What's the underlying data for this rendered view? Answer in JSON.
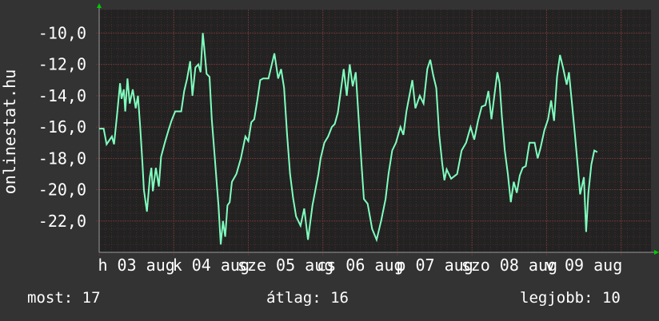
{
  "chart_data": {
    "type": "line",
    "ylabel": "onlinestat.hu",
    "ylim": [
      -24,
      -8.5
    ],
    "yticks": [
      -10,
      -12,
      -14,
      -16,
      -18,
      -20,
      -22
    ],
    "ytick_labels": [
      "-10,0",
      "-12,0",
      "-14,0",
      "-16,0",
      "-18,0",
      "-20,0",
      "-22,0"
    ],
    "xticks": [
      {
        "label": "h 03 aug",
        "x": 0.5
      },
      {
        "label": "k 04 aug",
        "x": 1.5
      },
      {
        "label": "sze 05 aug",
        "x": 2.5
      },
      {
        "label": "cs 06 aug",
        "x": 3.5
      },
      {
        "label": "p 07 aug",
        "x": 4.5
      },
      {
        "label": "szo 08 aug",
        "x": 5.5
      },
      {
        "label": "v 09 aug",
        "x": 6.5
      }
    ],
    "xlim": [
      0,
      7.4
    ],
    "grid": true,
    "colors": {
      "background": "#333333",
      "plot_background": "#222222",
      "grid": "#4a2d2d",
      "line": "#7fffbf",
      "axis_arrow": "#00cc00"
    },
    "series": [
      {
        "values": [
          [
            0.0,
            -16.1
          ],
          [
            0.06,
            -16.1
          ],
          [
            0.1,
            -17.1
          ],
          [
            0.17,
            -16.6
          ],
          [
            0.2,
            -17.1
          ],
          [
            0.24,
            -15.2
          ],
          [
            0.28,
            -13.2
          ],
          [
            0.3,
            -14.2
          ],
          [
            0.33,
            -13.6
          ],
          [
            0.35,
            -15.0
          ],
          [
            0.38,
            -12.9
          ],
          [
            0.41,
            -14.5
          ],
          [
            0.45,
            -13.6
          ],
          [
            0.49,
            -14.8
          ],
          [
            0.52,
            -14.0
          ],
          [
            0.55,
            -16.0
          ],
          [
            0.58,
            -18.3
          ],
          [
            0.6,
            -20.0
          ],
          [
            0.64,
            -21.4
          ],
          [
            0.68,
            -19.2
          ],
          [
            0.7,
            -18.6
          ],
          [
            0.72,
            -20.1
          ],
          [
            0.76,
            -18.6
          ],
          [
            0.8,
            -19.8
          ],
          [
            0.83,
            -17.9
          ],
          [
            0.88,
            -17.0
          ],
          [
            0.93,
            -16.2
          ],
          [
            0.97,
            -15.6
          ],
          [
            1.02,
            -15.0
          ],
          [
            1.1,
            -15.0
          ],
          [
            1.14,
            -13.7
          ],
          [
            1.18,
            -12.9
          ],
          [
            1.22,
            -11.8
          ],
          [
            1.25,
            -14.0
          ],
          [
            1.29,
            -12.2
          ],
          [
            1.33,
            -12.0
          ],
          [
            1.36,
            -12.5
          ],
          [
            1.39,
            -10.0
          ],
          [
            1.41,
            -11.0
          ],
          [
            1.44,
            -12.6
          ],
          [
            1.48,
            -12.8
          ],
          [
            1.51,
            -15.5
          ],
          [
            1.55,
            -17.9
          ],
          [
            1.58,
            -19.8
          ],
          [
            1.6,
            -21.0
          ],
          [
            1.63,
            -23.5
          ],
          [
            1.66,
            -22.0
          ],
          [
            1.69,
            -23.0
          ],
          [
            1.72,
            -21.0
          ],
          [
            1.75,
            -20.8
          ],
          [
            1.78,
            -19.5
          ],
          [
            1.84,
            -19.0
          ],
          [
            1.9,
            -18.0
          ],
          [
            1.96,
            -16.6
          ],
          [
            2.0,
            -16.9
          ],
          [
            2.04,
            -15.7
          ],
          [
            2.08,
            -15.5
          ],
          [
            2.12,
            -14.3
          ],
          [
            2.16,
            -13.0
          ],
          [
            2.2,
            -12.9
          ],
          [
            2.27,
            -12.9
          ],
          [
            2.32,
            -11.9
          ],
          [
            2.35,
            -11.3
          ],
          [
            2.4,
            -12.9
          ],
          [
            2.44,
            -12.3
          ],
          [
            2.48,
            -13.5
          ],
          [
            2.52,
            -16.5
          ],
          [
            2.56,
            -19.0
          ],
          [
            2.6,
            -20.5
          ],
          [
            2.64,
            -21.7
          ],
          [
            2.7,
            -22.3
          ],
          [
            2.75,
            -21.2
          ],
          [
            2.8,
            -23.2
          ],
          [
            2.86,
            -21.0
          ],
          [
            2.9,
            -20.0
          ],
          [
            2.94,
            -19.0
          ],
          [
            2.97,
            -18.0
          ],
          [
            3.02,
            -17.0
          ],
          [
            3.07,
            -16.6
          ],
          [
            3.12,
            -16.0
          ],
          [
            3.16,
            -15.8
          ],
          [
            3.2,
            -15.1
          ],
          [
            3.24,
            -13.7
          ],
          [
            3.28,
            -12.3
          ],
          [
            3.32,
            -14.0
          ],
          [
            3.36,
            -12.0
          ],
          [
            3.4,
            -13.4
          ],
          [
            3.44,
            -12.5
          ],
          [
            3.48,
            -15.5
          ],
          [
            3.52,
            -18.5
          ],
          [
            3.55,
            -20.6
          ],
          [
            3.6,
            -20.9
          ],
          [
            3.66,
            -22.5
          ],
          [
            3.72,
            -23.2
          ],
          [
            3.78,
            -22.0
          ],
          [
            3.84,
            -20.6
          ],
          [
            3.88,
            -19.0
          ],
          [
            3.93,
            -17.5
          ],
          [
            3.98,
            -17.0
          ],
          [
            4.04,
            -16.0
          ],
          [
            4.08,
            -16.5
          ],
          [
            4.12,
            -15.0
          ],
          [
            4.16,
            -14.0
          ],
          [
            4.2,
            -13.0
          ],
          [
            4.24,
            -14.8
          ],
          [
            4.3,
            -14.0
          ],
          [
            4.35,
            -14.5
          ],
          [
            4.4,
            -12.3
          ],
          [
            4.44,
            -11.7
          ],
          [
            4.48,
            -12.7
          ],
          [
            4.52,
            -13.5
          ],
          [
            4.56,
            -16.5
          ],
          [
            4.6,
            -18.3
          ],
          [
            4.63,
            -19.4
          ],
          [
            4.66,
            -18.7
          ],
          [
            4.72,
            -19.3
          ],
          [
            4.8,
            -19.0
          ],
          [
            4.86,
            -17.5
          ],
          [
            4.92,
            -17.0
          ],
          [
            4.98,
            -16.0
          ],
          [
            5.03,
            -16.8
          ],
          [
            5.08,
            -15.6
          ],
          [
            5.13,
            -14.7
          ],
          [
            5.18,
            -14.6
          ],
          [
            5.22,
            -13.7
          ],
          [
            5.26,
            -15.5
          ],
          [
            5.31,
            -13.6
          ],
          [
            5.34,
            -12.5
          ],
          [
            5.37,
            -13.2
          ],
          [
            5.4,
            -15.3
          ],
          [
            5.44,
            -17.5
          ],
          [
            5.48,
            -19.0
          ],
          [
            5.52,
            -20.8
          ],
          [
            5.56,
            -19.5
          ],
          [
            5.6,
            -20.2
          ],
          [
            5.64,
            -19.1
          ],
          [
            5.68,
            -18.6
          ],
          [
            5.72,
            -18.5
          ],
          [
            5.77,
            -17.0
          ],
          [
            5.84,
            -17.0
          ],
          [
            5.88,
            -18.0
          ],
          [
            5.92,
            -17.3
          ],
          [
            5.97,
            -16.2
          ],
          [
            6.02,
            -15.5
          ],
          [
            6.06,
            -14.3
          ],
          [
            6.1,
            -15.6
          ],
          [
            6.14,
            -12.8
          ],
          [
            6.18,
            -11.4
          ],
          [
            6.22,
            -12.2
          ],
          [
            6.27,
            -13.3
          ],
          [
            6.3,
            -12.5
          ],
          [
            6.34,
            -14.5
          ],
          [
            6.38,
            -16.5
          ],
          [
            6.42,
            -18.6
          ],
          [
            6.45,
            -20.3
          ],
          [
            6.5,
            -19.2
          ],
          [
            6.53,
            -22.7
          ],
          [
            6.56,
            -20.2
          ],
          [
            6.6,
            -18.4
          ],
          [
            6.64,
            -17.5
          ],
          [
            6.68,
            -17.6
          ]
        ]
      }
    ]
  },
  "stats": {
    "now": "most: 17",
    "avg": "átlag: 16",
    "best": "legjobb: 10"
  }
}
